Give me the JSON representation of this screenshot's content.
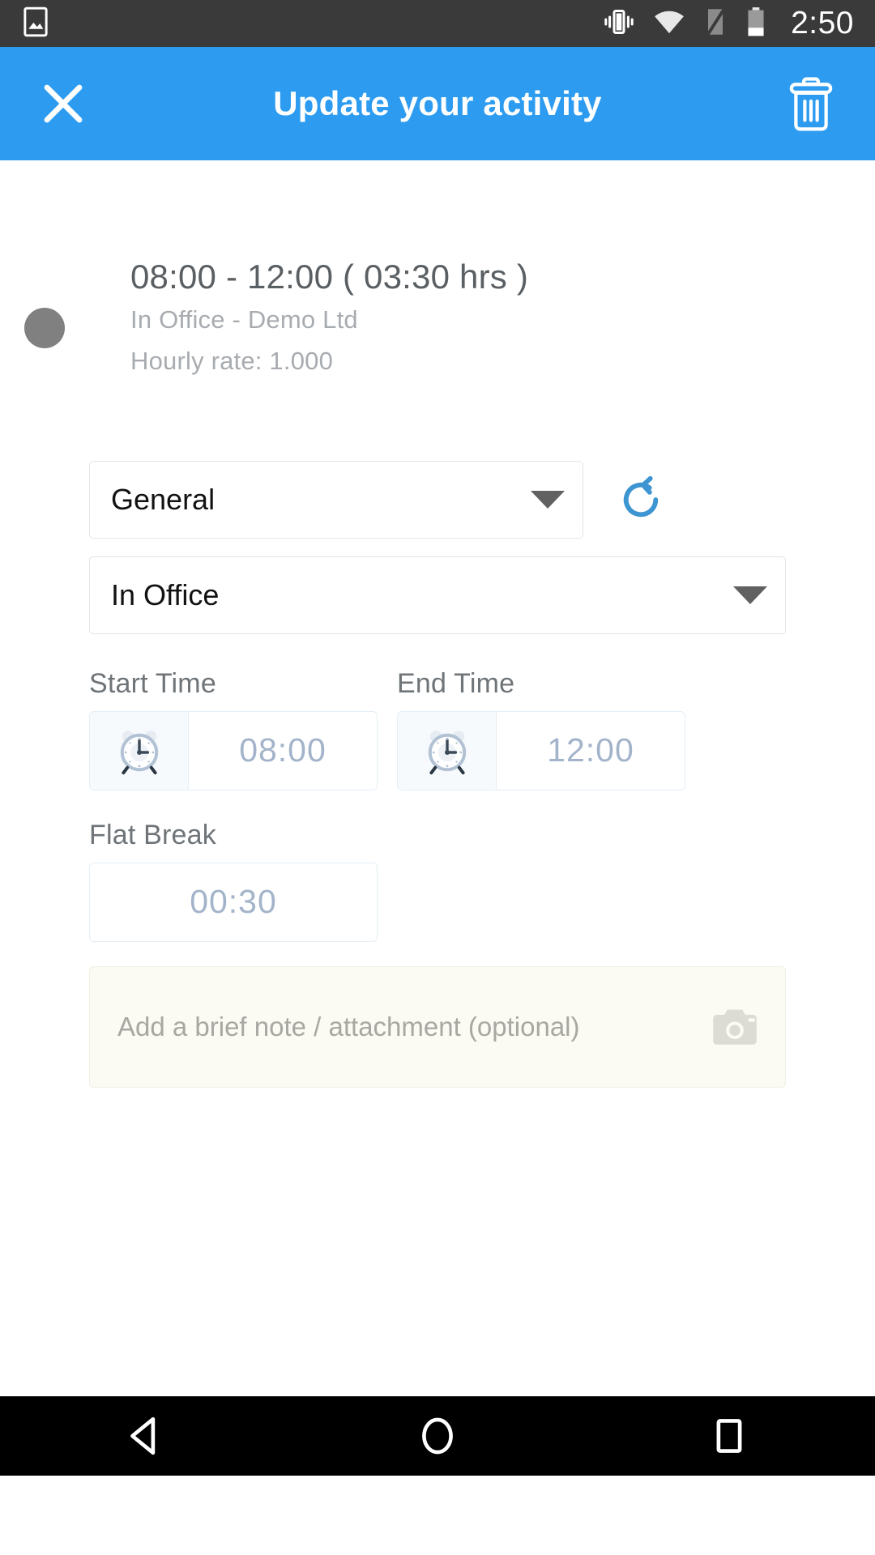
{
  "status_bar": {
    "time": "2:50",
    "icons": [
      "image-icon",
      "vibrate-icon",
      "wifi-icon",
      "sim-card-icon",
      "battery-icon"
    ],
    "background": "#3a3a3a"
  },
  "app_bar": {
    "title": "Update your activity",
    "close_icon": "close-icon",
    "delete_icon": "trash-icon",
    "background": "#2d9cf0"
  },
  "activity": {
    "time_range": "08:00 - 12:00 ( 03:30 hrs )",
    "location_client": "In Office - Demo Ltd",
    "hourly_rate": "Hourly rate: 1.000",
    "avatar_color": "#808080"
  },
  "form": {
    "category_select": {
      "value": "General",
      "caret_icon": "chevron-down-icon"
    },
    "refresh": {
      "icon": "refresh-icon",
      "color": "#3d95d1"
    },
    "activity_type_select": {
      "value": "In Office",
      "caret_icon": "chevron-down-icon"
    },
    "start_time": {
      "label": "Start Time",
      "value": "08:00",
      "icon": "alarm-clock-icon"
    },
    "end_time": {
      "label": "End Time",
      "value": "12:00",
      "icon": "alarm-clock-icon"
    },
    "flat_break": {
      "label": "Flat Break",
      "value": "00:30"
    },
    "note": {
      "placeholder": "Add a brief note / attachment (optional)",
      "camera_icon": "camera-icon",
      "background": "#fbfaf3"
    }
  },
  "nav_bar": {
    "back": "back-icon",
    "home": "home-icon",
    "recents": "recents-icon"
  }
}
